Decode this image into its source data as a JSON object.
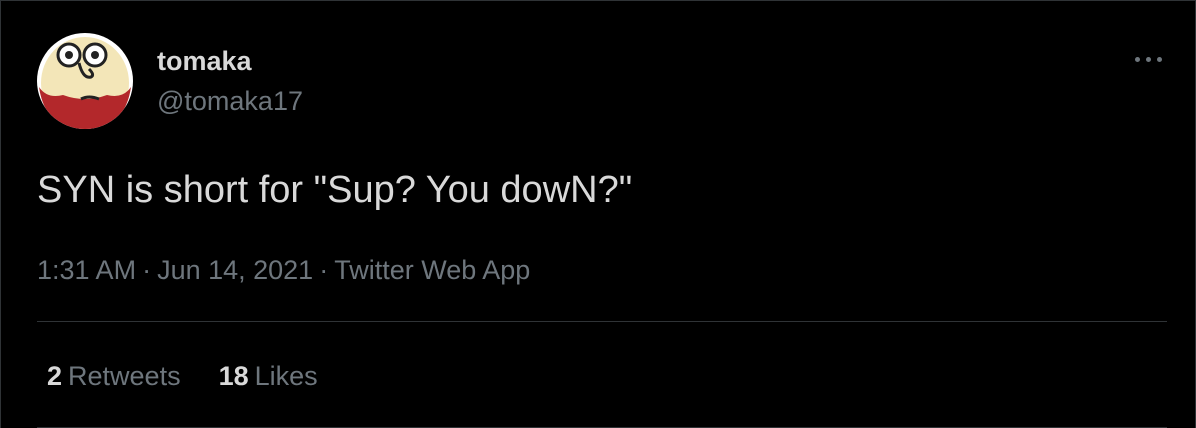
{
  "user": {
    "display_name": "tomaka",
    "handle": "@tomaka17",
    "avatar_icon": "cartoon-face-avatar"
  },
  "tweet": {
    "text": "SYN is short for \"Sup? You dowN?\"",
    "time": "1:31 AM",
    "separator": "·",
    "date": "Jun 14, 2021",
    "source": "Twitter Web App"
  },
  "stats": {
    "retweets_count": "2",
    "retweets_label": "Retweets",
    "likes_count": "18",
    "likes_label": "Likes"
  },
  "menu": {
    "icon": "more-horizontal-icon"
  },
  "colors": {
    "background": "#000000",
    "primary_text": "#d9d9d9",
    "secondary_text": "#6e767d",
    "divider": "#2f3336",
    "avatar_red": "#b3282b"
  }
}
